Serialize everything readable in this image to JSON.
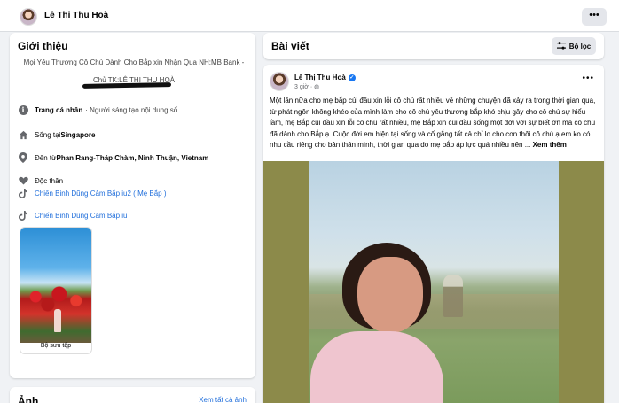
{
  "topbar": {
    "name": "Lê Thị Thu Hoà",
    "more": "•••"
  },
  "intro": {
    "title": "Giới thiệu",
    "bio_line1": "Mọi Yêu Thương Cô Chú Dành Cho Bắp xin Nhận Qua NH:MB Bank -",
    "bio_line2": "Chủ TK:LÊ THỊ THU HOÀ",
    "items": [
      {
        "icon": "info-icon",
        "bold": "Trang cá nhân",
        "text": " · Người sáng tạo nội dung số"
      },
      {
        "icon": "home-icon",
        "prefix": "Sống tại ",
        "bold": "Singapore"
      },
      {
        "icon": "location-pin-icon",
        "prefix": "Đến từ ",
        "bold": "Phan Rang-Tháp Chàm, Ninh Thuận, Vietnam"
      },
      {
        "icon": "heart-icon",
        "text": "Độc thân"
      },
      {
        "icon": "tiktok-icon",
        "text": "Chiến Binh Dũng Cảm Bắp iu2 ( Mẹ Bắp )"
      },
      {
        "icon": "tiktok-icon",
        "text": "Chiến Binh Dũng Cảm Bắp iu"
      }
    ],
    "collection_label": "Bộ sưu tập"
  },
  "photos": {
    "title": "Ảnh",
    "see_all": "Xem tất cả ảnh"
  },
  "posts": {
    "title": "Bài viết",
    "filter_label": "Bộ lọc"
  },
  "post": {
    "author": "Lê Thị Thu Hoà",
    "time": "3 giờ · ",
    "text": "Một lần nữa cho mẹ bắp cúi đầu xin lỗi cô chú rất nhiều về những chuyện đã xảy ra trong thời gian qua, từ phát ngôn không khéo của mình làm cho cô chú yêu thương bắp khó chịu gây cho cô chú sự hiểu lầm, mẹ Bắp cúi đầu xin lỗi cô chú rất nhiều, mẹ Bắp xin cúi đầu sống một đời với sự biết ơn mà cô chú đã dành cho Bắp ạ. Cuộc đời em hiện tại sống và cố gắng tất cả chỉ lo cho con thôi cô chú ạ em ko có nhu cầu riêng cho bản thân mình, thời gian qua do mẹ bắp áp lực quá nhiều nên ... ",
    "see_more": "Xem thêm",
    "more": "•••"
  }
}
